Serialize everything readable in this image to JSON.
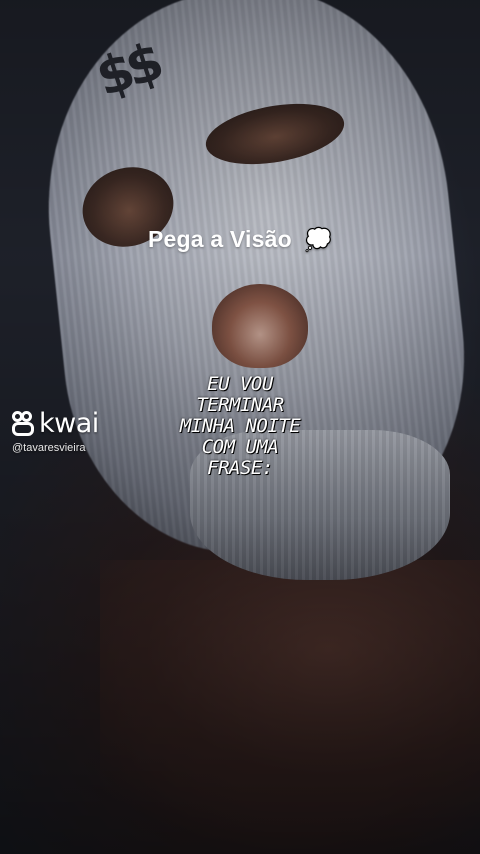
{
  "video": {
    "caption": "Pega a Visão",
    "caption_emoji": "💭",
    "phrase_lines": [
      "EU VOU",
      "TERMINAR",
      "MINHA NOITE",
      "COM UMA",
      "FRASE:"
    ]
  },
  "watermark": {
    "brand": "kwai",
    "handle": "@tavaresvieira"
  },
  "artwork": {
    "emblem": "$$"
  },
  "colors": {
    "mask": "#b6bac4",
    "background": "#15161b",
    "text": "#ffffff"
  }
}
